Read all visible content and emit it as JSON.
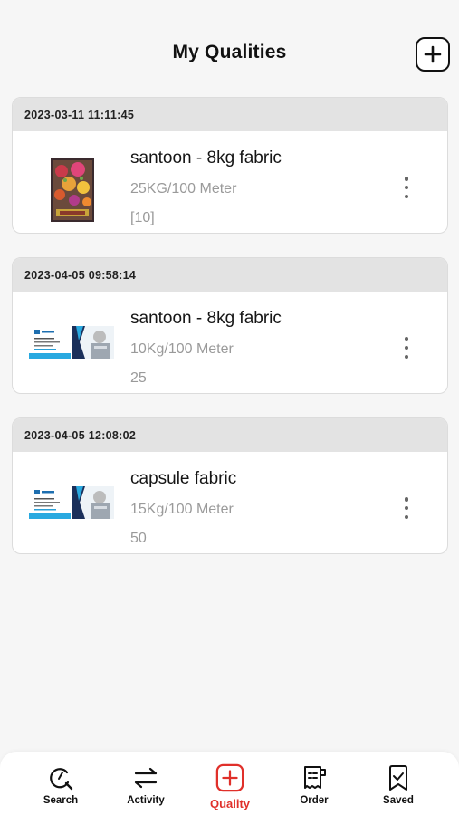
{
  "header": {
    "title": "My Qualities"
  },
  "qualities": [
    {
      "timestamp": "2023-03-11 11:11:45",
      "name": "santoon - 8kg fabric",
      "weight": "25KG/100 Meter",
      "count": "[10]",
      "thumbnail": "flower-catalog"
    },
    {
      "timestamp": "2023-04-05 09:58:14",
      "name": "santoon - 8kg fabric",
      "weight": "10Kg/100 Meter",
      "count": "25",
      "thumbnail": "business-card"
    },
    {
      "timestamp": "2023-04-05 12:08:02",
      "name": "capsule fabric",
      "weight": "15Kg/100 Meter",
      "count": "50",
      "thumbnail": "business-card"
    }
  ],
  "tabbar": {
    "tabs": [
      {
        "label": "Search",
        "icon": "search-icon"
      },
      {
        "label": "Activity",
        "icon": "swap-arrows-icon"
      },
      {
        "label": "Quality",
        "icon": "plus-square-icon",
        "active": true
      },
      {
        "label": "Order",
        "icon": "receipt-icon"
      },
      {
        "label": "Saved",
        "icon": "bookmark-check-icon"
      }
    ]
  },
  "colors": {
    "accent": "#e0302a",
    "card_header": "#e3e3e3",
    "background": "#f6f6f6",
    "muted_text": "#9a9a9a"
  }
}
